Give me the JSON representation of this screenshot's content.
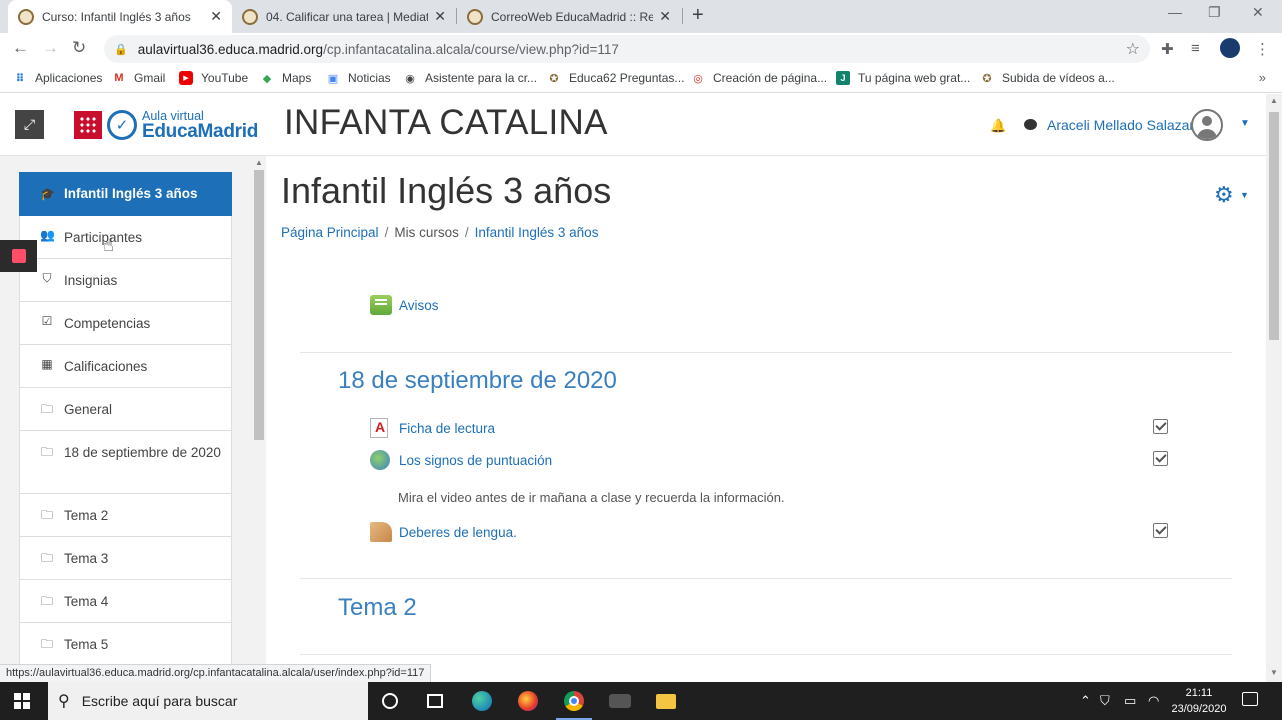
{
  "browser": {
    "tabs": [
      {
        "title": "Curso: Infantil Inglés 3 años",
        "active": true
      },
      {
        "title": "04. Calificar una tarea | Mediatec",
        "active": false
      },
      {
        "title": "CorreoWeb EducaMadrid :: Reda",
        "active": false
      }
    ],
    "url_host": "aulavirtual36.educa.madrid.org",
    "url_path": "/cp.infantacatalina.alcala/course/view.php?id=117",
    "bookmarks": [
      {
        "label": "Aplicaciones",
        "icon": "apps-grid-icon"
      },
      {
        "label": "Gmail",
        "icon": "gmail-icon"
      },
      {
        "label": "YouTube",
        "icon": "youtube-icon"
      },
      {
        "label": "Maps",
        "icon": "maps-icon"
      },
      {
        "label": "Noticias",
        "icon": "news-icon"
      },
      {
        "label": "Asistente para la cr...",
        "icon": "globe-icon"
      },
      {
        "label": "Educa62 Preguntas...",
        "icon": "educa-icon"
      },
      {
        "label": "Creación de página...",
        "icon": "target-icon"
      },
      {
        "label": "Tu página web grat...",
        "icon": "web-icon"
      },
      {
        "label": "Subida de vídeos a...",
        "icon": "educa-icon"
      }
    ],
    "status_url": "https://aulavirtual36.educa.madrid.org/cp.infantacatalina.alcala/user/index.php?id=117"
  },
  "header": {
    "logo_line1": "Aula virtual",
    "logo_line2": "EducaMadrid",
    "site_title": "INFANTA CATALINA",
    "user_name": "Araceli Mellado Salazar"
  },
  "nav": {
    "items": [
      {
        "label": "Infantil Inglés 3 años",
        "icon": "graduation-cap-icon",
        "active": true
      },
      {
        "label": "Participantes",
        "icon": "users-icon"
      },
      {
        "label": "Insignias",
        "icon": "shield-icon"
      },
      {
        "label": "Competencias",
        "icon": "checkbox-icon"
      },
      {
        "label": "Calificaciones",
        "icon": "table-icon"
      },
      {
        "label": "General",
        "icon": "folder-icon"
      },
      {
        "label": "18 de septiembre de 2020",
        "icon": "folder-icon"
      },
      {
        "label": "Tema 2",
        "icon": "folder-icon"
      },
      {
        "label": "Tema 3",
        "icon": "folder-icon"
      },
      {
        "label": "Tema 4",
        "icon": "folder-icon"
      },
      {
        "label": "Tema 5",
        "icon": "folder-icon"
      }
    ]
  },
  "main": {
    "course_title": "Infantil Inglés 3 años",
    "breadcrumb": [
      "Página Principal",
      "Mis cursos",
      "Infantil Inglés 3 años"
    ],
    "avisos": "Avisos",
    "section1_title": "18 de septiembre de 2020",
    "activities": [
      {
        "label": "Ficha de lectura",
        "icon": "pdf-icon"
      },
      {
        "label": "Los signos de puntuación",
        "icon": "url-globe-icon"
      },
      {
        "label": "Deberes de lengua.",
        "icon": "assignment-icon"
      }
    ],
    "description": "Mira el video antes de ir mañana a clase y recuerda la información.",
    "section2_title": "Tema 2"
  },
  "taskbar": {
    "search_placeholder": "Escribe aquí para buscar",
    "time": "21:11",
    "date": "23/09/2020"
  },
  "colors": {
    "accent": "#1d6fb8",
    "section_title": "#3a80c1"
  }
}
